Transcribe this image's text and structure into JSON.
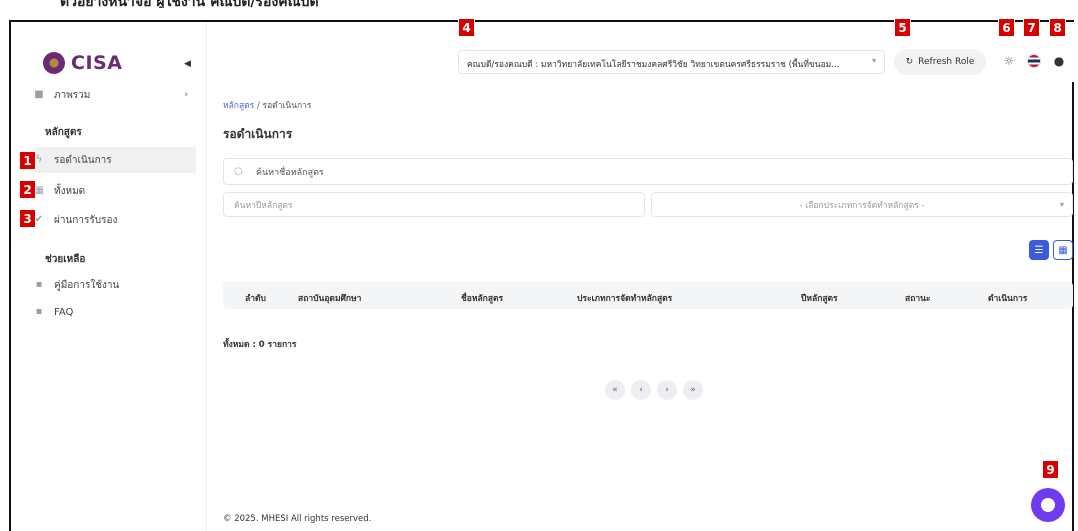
{
  "app": {
    "logo_text": "CISA"
  },
  "sidebar": {
    "items": [
      {
        "label": "ภาพรวม",
        "icon": "dashboard-icon"
      },
      {
        "section": "หลักสูตร"
      },
      {
        "label": "รอดำเนินการ",
        "icon": "bolt-icon",
        "active": true,
        "tag": "1"
      },
      {
        "label": "ทั้งหมด",
        "icon": "grid-icon",
        "tag": "2"
      },
      {
        "label": "ผ่านการรับรอง",
        "icon": "check-circle-icon",
        "tag": "3"
      },
      {
        "section": "ช่วยเหลือ"
      },
      {
        "label": "คู่มือการใช้งาน",
        "icon": "book-icon"
      },
      {
        "label": "FAQ",
        "icon": "book-icon"
      }
    ]
  },
  "header": {
    "org_select": "คณบดี/รองคณบดี : มหาวิทยาลัยเทคโนโลยีราชมงคลศรีวิชัย วิทยาเขตนครศรีธรรมราช (พื้นที่ขนอม...",
    "refresh_label": "Refresh Role",
    "tags": [
      "4",
      "5",
      "6",
      "7",
      "8"
    ]
  },
  "main": {
    "breadcrumb_link": "หลักสูตร",
    "breadcrumb_sep": "/",
    "breadcrumb_current": "รอดำเนินการ",
    "title": "รอดำเนินการ",
    "search_placeholder": "ค้นหาชื่อหลักสูตร",
    "year_placeholder": "ค้นหาปีหลักสูตร",
    "type_placeholder": "- เลือกประเภทการจัดทำหลักสูตร -",
    "columns": [
      "ลำดับ",
      "สถาบันอุดมศึกษา",
      "ชื่อหลักสูตร",
      "ประเภทการจัดทำหลักสูตร",
      "ปีหลักสูตร",
      "สถานะ",
      "ดำเนินการ"
    ],
    "total": "ทั้งหมด : 0 รายการ",
    "pager": [
      "«",
      "‹",
      "›",
      "»"
    ]
  },
  "footer": "© 2025. MHESI All rights reserved.",
  "chat_tag": "9",
  "colors": {
    "brand": "#6b2a74",
    "accent": "#3b5bdb",
    "chat": "#6f3df0",
    "tag": "#d90000"
  }
}
